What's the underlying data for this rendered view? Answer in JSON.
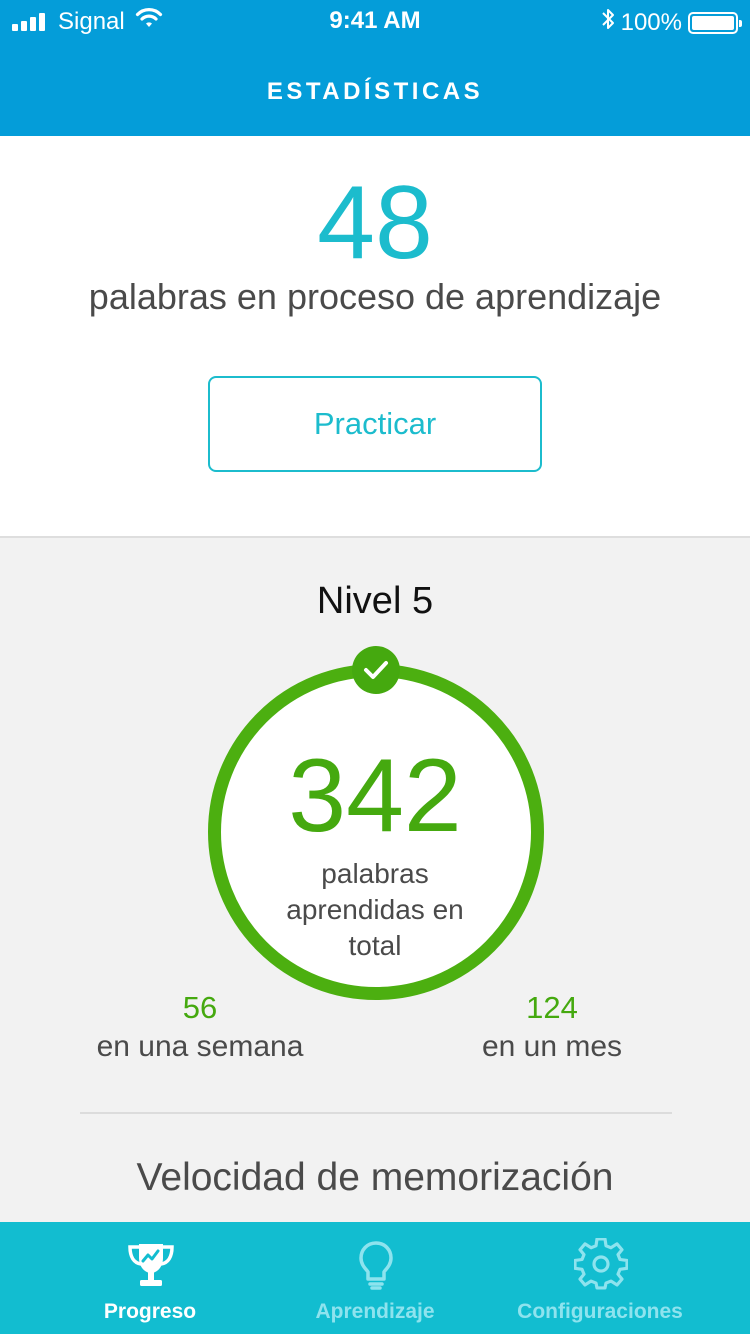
{
  "status_bar": {
    "carrier": "Signal",
    "time": "9:41 AM",
    "battery": "100%",
    "icons": [
      "signal-bars-icon",
      "wifi-icon",
      "bluetooth-icon",
      "battery-icon"
    ]
  },
  "header": {
    "title": "ESTADÍSTICAS"
  },
  "learning": {
    "count": "48",
    "label": "palabras en proceso de aprendizaje",
    "practice_label": "Practicar"
  },
  "level": {
    "title": "Nivel 5",
    "total": "342",
    "total_label": "palabras aprendidas en total",
    "week_value": "56",
    "week_label": "en una semana",
    "month_value": "124",
    "month_label": "en un mes"
  },
  "section": {
    "title": "Velocidad de memorización"
  },
  "tabs": [
    {
      "label": "Progreso",
      "icon": "trophy-icon",
      "active": true
    },
    {
      "label": "Aprendizaje",
      "icon": "lightbulb-icon",
      "active": false
    },
    {
      "label": "Configuraciones",
      "icon": "gear-icon",
      "active": false
    }
  ],
  "colors": {
    "header": "#049dd9",
    "accent": "#1cbccd",
    "green": "#45a90f",
    "tabbar": "#12bdd0"
  }
}
